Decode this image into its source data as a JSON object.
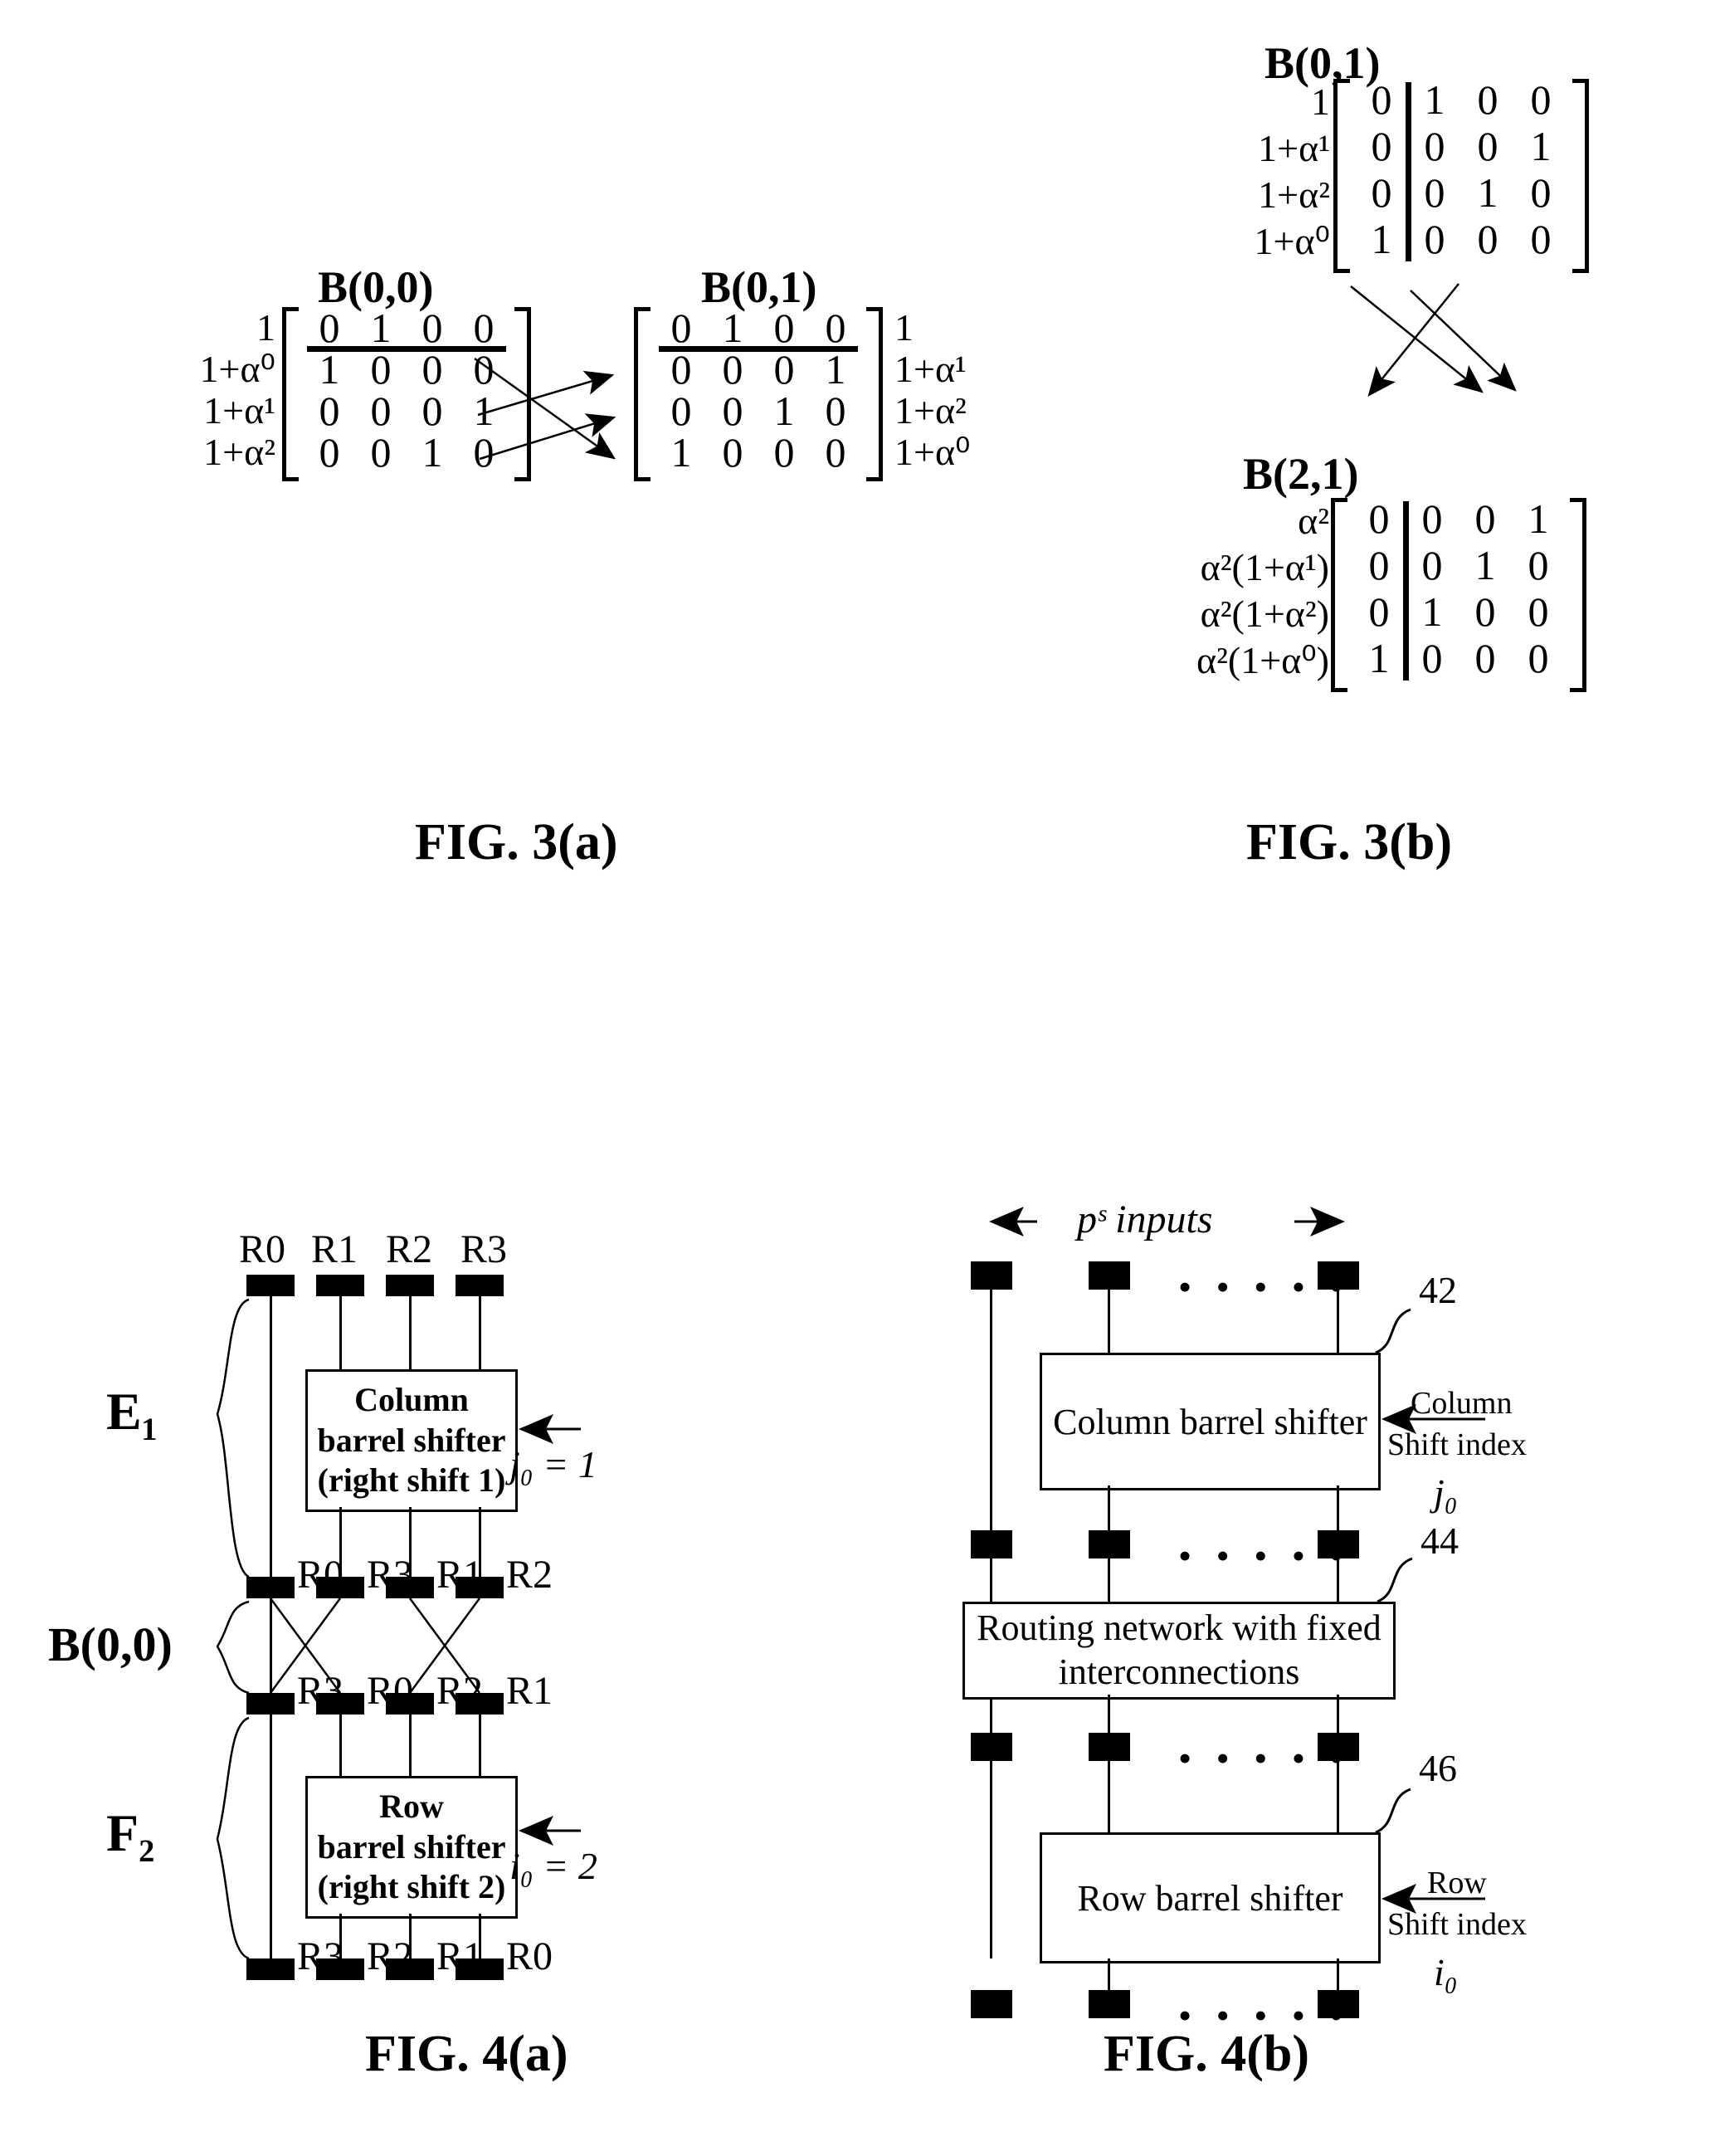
{
  "figures": {
    "fig3a": {
      "caption": "FIG. 3(a)",
      "left_matrix": {
        "title": "B(0,0)",
        "row_labels": [
          "1",
          "1+α⁰",
          "1+α¹",
          "1+α²"
        ],
        "rows": [
          [
            "0",
            "1",
            "0",
            "0"
          ],
          [
            "1",
            "0",
            "0",
            "0"
          ],
          [
            "0",
            "0",
            "0",
            "1"
          ],
          [
            "0",
            "0",
            "1",
            "0"
          ]
        ],
        "separator": "horizontal-after-row-1",
        "label_side": "left"
      },
      "right_matrix": {
        "title": "B(0,1)",
        "row_labels": [
          "1",
          "1+α¹",
          "1+α²",
          "1+α⁰"
        ],
        "rows": [
          [
            "0",
            "1",
            "0",
            "0"
          ],
          [
            "0",
            "0",
            "0",
            "1"
          ],
          [
            "0",
            "0",
            "1",
            "0"
          ],
          [
            "1",
            "0",
            "0",
            "0"
          ]
        ],
        "separator": "horizontal-after-row-1",
        "label_side": "right"
      },
      "arrows": 3
    },
    "fig3b": {
      "caption": "FIG. 3(b)",
      "top_matrix": {
        "title": "B(0,1)",
        "row_labels": [
          "1",
          "1+α¹",
          "1+α²",
          "1+α⁰"
        ],
        "rows": [
          [
            "0",
            "1",
            "0",
            "0"
          ],
          [
            "0",
            "0",
            "0",
            "1"
          ],
          [
            "0",
            "0",
            "1",
            "0"
          ],
          [
            "1",
            "0",
            "0",
            "0"
          ]
        ],
        "separator": "vertical-after-col-1",
        "label_side": "left"
      },
      "bottom_matrix": {
        "title": "B(2,1)",
        "row_labels": [
          "α²",
          "α²(1+α¹)",
          "α²(1+α²)",
          "α²(1+α⁰)"
        ],
        "rows": [
          [
            "0",
            "0",
            "0",
            "1"
          ],
          [
            "0",
            "0",
            "1",
            "0"
          ],
          [
            "0",
            "1",
            "0",
            "0"
          ],
          [
            "1",
            "0",
            "0",
            "0"
          ]
        ],
        "separator": "vertical-after-col-1",
        "label_side": "left"
      },
      "arrows": 3
    },
    "fig4a": {
      "caption": "FIG. 4(a)",
      "brace_labels": [
        "E₁",
        "B(0,0)",
        "F₂"
      ],
      "rows": [
        {
          "name": "input-row",
          "labels": [
            "R0",
            "R1",
            "R2",
            "R3"
          ],
          "label_pos": "above"
        },
        {
          "name": "stage1-out",
          "labels": [
            "R0",
            "R3",
            "R1",
            "R2"
          ],
          "label_pos": "right"
        },
        {
          "name": "stage2-out",
          "labels": [
            "R3",
            "R0",
            "R2",
            "R1"
          ],
          "label_pos": "right"
        },
        {
          "name": "output-row",
          "labels": [
            "R3",
            "R2",
            "R1",
            "R0"
          ],
          "label_pos": "right"
        }
      ],
      "column_shifter": {
        "line1": "Column",
        "line2": "barrel shifter",
        "line3": "(right shift 1)",
        "index": "j₀ = 1"
      },
      "row_shifter": {
        "line1": "Row",
        "line2": "barrel shifter",
        "line3": "(right shift 2)",
        "index": "i₀ = 2"
      }
    },
    "fig4b": {
      "caption": "FIG. 4(b)",
      "top_annotation": "pˢ inputs",
      "dots": "• • • • •",
      "blocks": [
        {
          "label": "Column barrel shifter",
          "callout": "42",
          "side_line1": "Column",
          "side_line2": "Shift index",
          "index": "j₀"
        },
        {
          "label": "Routing network with fixed interconnections",
          "callout": "44",
          "side_line1": "",
          "side_line2": "",
          "index": ""
        },
        {
          "label": "Row barrel shifter",
          "callout": "46",
          "side_line1": "Row",
          "side_line2": "Shift index",
          "index": "i₀"
        }
      ]
    }
  }
}
